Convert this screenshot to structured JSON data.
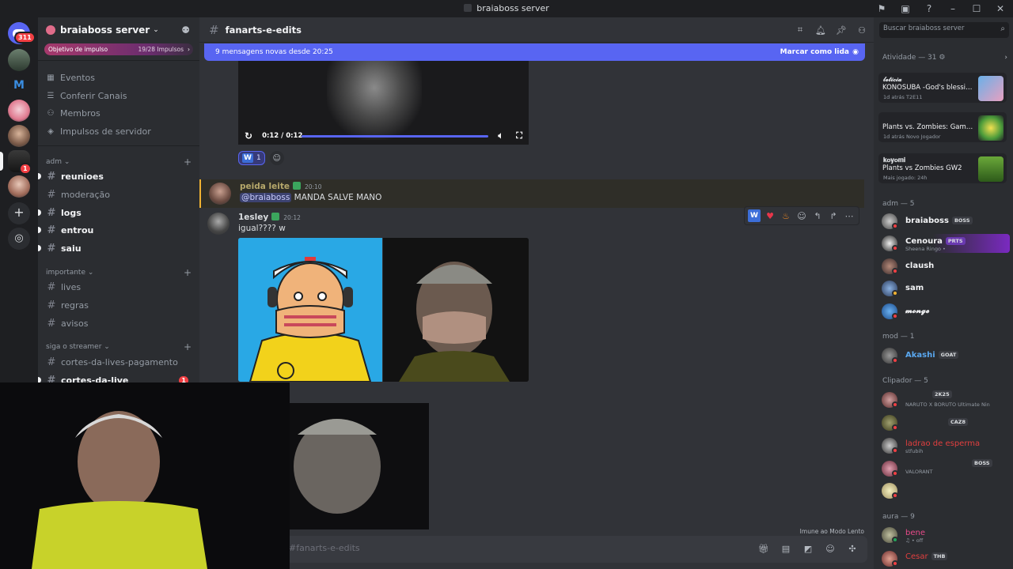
{
  "window": {
    "title": "braiaboss server"
  },
  "rail": {
    "unread_count": "311",
    "server_badge": "1"
  },
  "guild": {
    "name": "braiaboss server",
    "boost_goal": "Objetivo de impulso",
    "boost_progress": "19/28 Impulsos",
    "menu": [
      "Eventos",
      "Conferir Canais",
      "Membros",
      "Impulsos de servidor"
    ]
  },
  "categories": [
    {
      "name": "adm",
      "channels": [
        {
          "name": "reunioes",
          "unread": true
        },
        {
          "name": "moderação",
          "unread": false
        },
        {
          "name": "logs",
          "unread": true
        },
        {
          "name": "entrou",
          "unread": true
        },
        {
          "name": "saiu",
          "unread": true
        }
      ]
    },
    {
      "name": "importante",
      "channels": [
        {
          "name": "lives",
          "unread": false
        },
        {
          "name": "regras",
          "unread": false
        },
        {
          "name": "avisos",
          "unread": false
        }
      ]
    },
    {
      "name": "siga o streamer",
      "channels": [
        {
          "name": "cortes-da-lives-pagamento",
          "unread": false
        },
        {
          "name": "cortes-da-live",
          "unread": true,
          "count": "1"
        }
      ]
    }
  ],
  "channel": {
    "name": "fanarts-e-edits"
  },
  "new_messages_bar": {
    "text": "9 mensagens novas desde 20:25",
    "action": "Marcar como lida"
  },
  "video": {
    "time": "0:12 / 0:12"
  },
  "reaction": {
    "count": "1",
    "letter": "W"
  },
  "messages": [
    {
      "author": "peida leite",
      "time": "20:10",
      "mention": "@braiaboss",
      "text": "MANDA SALVE MANO",
      "color": "#b6a86b"
    },
    {
      "author": "1esley",
      "time": "20:12",
      "text": "igual???? w",
      "color": "#dbdee1"
    }
  ],
  "composer": {
    "placeholder": "#fanarts-e-edits",
    "slow_mode": "Imune ao Modo Lento"
  },
  "member_search": {
    "placeholder": "Buscar braiaboss server"
  },
  "activity": {
    "header": "Atividade — 31",
    "cards": [
      {
        "who": "𝓵𝓮𝓽𝓲𝓬𝓲𝓪",
        "game": "KONOSUBA -God's blessin...",
        "meta": "1d atrás   T2E11"
      },
      {
        "who": "",
        "game": "Plants vs. Zombies: Game ...",
        "meta": "1d atrás   Novo Jogador"
      },
      {
        "who": "𝐤𝐨𝐲𝐨𝐦𝐢",
        "game": "Plants vs Zombies GW2",
        "meta": "Mais jogado: 24h"
      }
    ]
  },
  "member_groups": [
    {
      "label": "adm — 5",
      "members": [
        {
          "name": "braiaboss",
          "tag": "BOSS",
          "status": "",
          "color": "#f2f3f5"
        },
        {
          "name": "Cenoura",
          "tag": "PRTS",
          "status": "Sheena Ringo • ",
          "color": "#f2f3f5"
        },
        {
          "name": "claush",
          "tag": "",
          "status": "",
          "color": "#f2f3f5"
        },
        {
          "name": "sam",
          "tag": "",
          "status": "",
          "color": "#f2f3f5"
        },
        {
          "name": "𝓶𝓸𝓷𝓰𝓮",
          "tag": "",
          "status": "",
          "color": "#f2f3f5"
        }
      ]
    },
    {
      "label": "mod — 1",
      "members": [
        {
          "name": "Akashi",
          "tag": "GOAT",
          "status": "",
          "color": "#5aa8f0"
        }
      ]
    },
    {
      "label": "Clipador — 5",
      "members": [
        {
          "name": "",
          "tag": "2K25",
          "status": "NARUTO X BORUTO Ultimate Nin",
          "color": "#f2f3f5"
        },
        {
          "name": "",
          "tag": "CAZ8",
          "status": "",
          "color": "#f2f3f5"
        },
        {
          "name": "ladrao de esperma",
          "tag": "",
          "status": "stfubih",
          "color": "#e23f3f"
        },
        {
          "name": "",
          "tag": "BOSS",
          "status": "VALORANT",
          "color": "#f2f3f5"
        },
        {
          "name": "",
          "tag": "",
          "status": "",
          "color": "#f2f3f5"
        }
      ]
    },
    {
      "label": "aura — 9",
      "members": [
        {
          "name": "bene",
          "tag": "",
          "status": "♫ • off",
          "color": "#e84a8a"
        },
        {
          "name": "Cesar",
          "tag": "THB",
          "status": "",
          "color": "#e23f3f"
        }
      ]
    }
  ],
  "colors": {
    "accent": "#5865f2",
    "bg_main": "#313338",
    "bg_side": "#2b2d31",
    "bg_rail": "#1e1f22"
  }
}
